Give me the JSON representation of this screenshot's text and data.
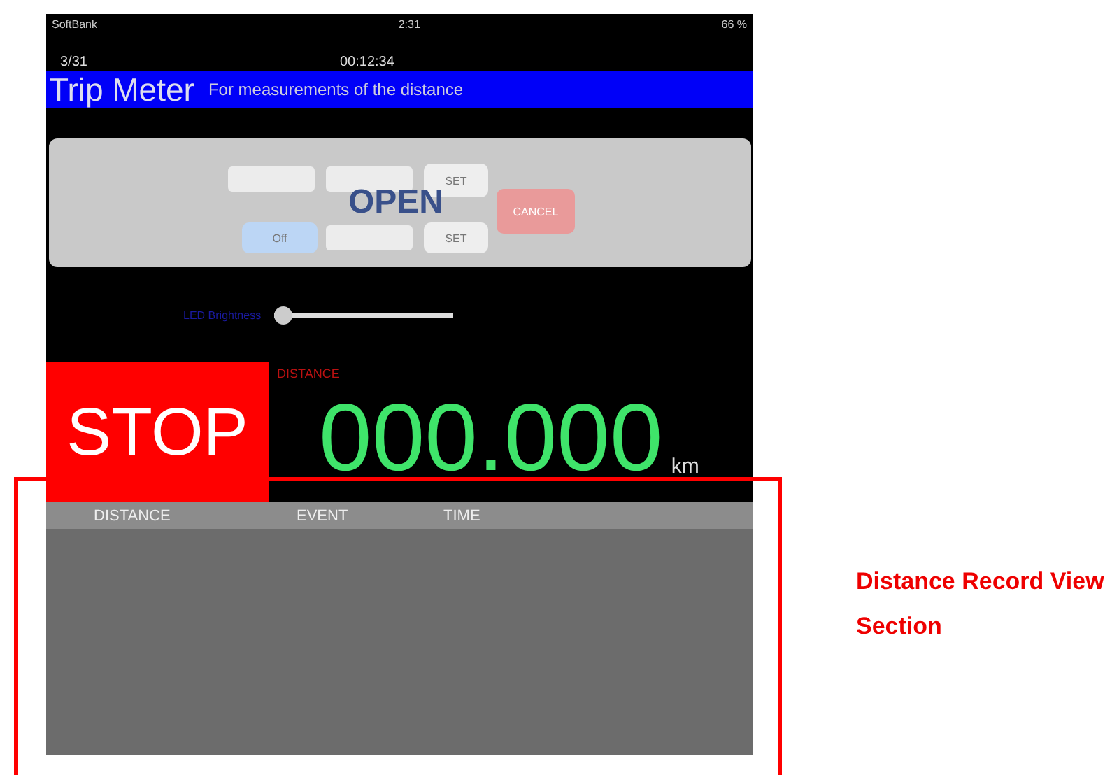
{
  "status_bar": {
    "carrier": "SoftBank",
    "time": "2:31",
    "battery": "66 %"
  },
  "info": {
    "date": "3/31",
    "elapsed": "00:12:34"
  },
  "title_bar": {
    "title": "Trip Meter",
    "subtitle": "For measurements of the distance"
  },
  "settings_panel": {
    "overlay": "OPEN",
    "buttons": [
      {
        "label": "SET",
        "kind": "set"
      },
      {
        "label": "Off",
        "kind": "toggle"
      },
      {
        "label": "SET",
        "kind": "set"
      },
      {
        "label": "CANCEL",
        "kind": "cancel"
      }
    ]
  },
  "brightness": {
    "label": "LED Brightness",
    "level": 0.03
  },
  "meter": {
    "button": "STOP",
    "label": "DISTANCE",
    "value": "000.000",
    "unit": "km"
  },
  "record_table": {
    "columns": [
      "DISTANCE",
      "EVENT",
      "TIME"
    ]
  },
  "annotation": {
    "label": "Distance Record View Section"
  }
}
